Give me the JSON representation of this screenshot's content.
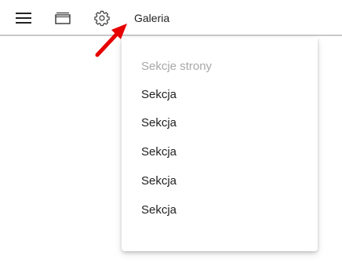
{
  "toolbar": {
    "icons": {
      "menu": "hamburger-menu-icon",
      "window": "window-icon",
      "settings": "gear-icon"
    },
    "gallery_label": "Galeria"
  },
  "annotation": {
    "color": "#e60000"
  },
  "dropdown": {
    "header": "Sekcje strony",
    "items": [
      {
        "label": "Sekcja"
      },
      {
        "label": "Sekcja"
      },
      {
        "label": "Sekcja"
      },
      {
        "label": "Sekcja"
      },
      {
        "label": "Sekcja"
      }
    ]
  }
}
